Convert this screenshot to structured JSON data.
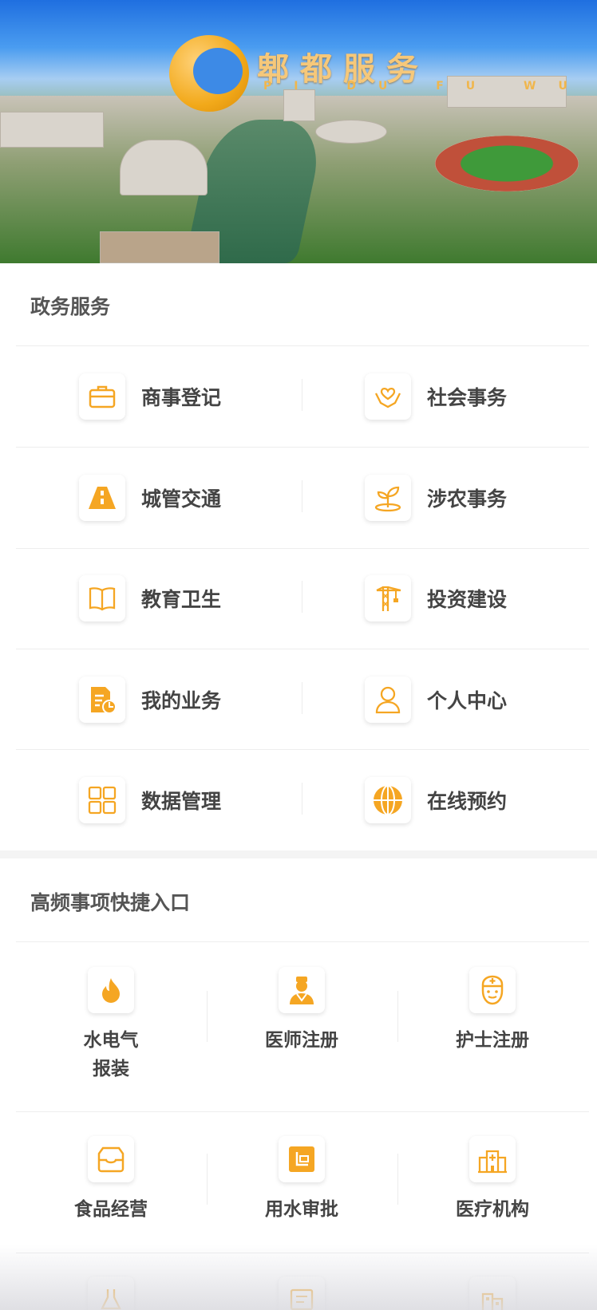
{
  "banner": {
    "title": "郫都服务",
    "subtitle": "PI DU FU WU"
  },
  "gov_section": {
    "title": "政务服务",
    "items": [
      {
        "label": "商事登记",
        "icon": "briefcase-icon"
      },
      {
        "label": "社会事务",
        "icon": "heart-hands-icon"
      },
      {
        "label": "城管交通",
        "icon": "road-icon"
      },
      {
        "label": "涉农事务",
        "icon": "sprout-icon"
      },
      {
        "label": "教育卫生",
        "icon": "book-icon"
      },
      {
        "label": "投资建设",
        "icon": "crane-icon"
      },
      {
        "label": "我的业务",
        "icon": "document-icon"
      },
      {
        "label": "个人中心",
        "icon": "person-icon"
      },
      {
        "label": "数据管理",
        "icon": "grid-icon"
      },
      {
        "label": "在线预约",
        "icon": "globe-icon"
      }
    ]
  },
  "quick_section": {
    "title": "高频事项快捷入口",
    "items": [
      {
        "label": "水电气\n报装",
        "icon": "flame-icon"
      },
      {
        "label": "医师注册",
        "icon": "doctor-icon"
      },
      {
        "label": "护士注册",
        "icon": "nurse-icon"
      },
      {
        "label": "食品经营",
        "icon": "food-box-icon"
      },
      {
        "label": "用水审批",
        "icon": "water-approval-icon"
      },
      {
        "label": "医疗机构",
        "icon": "hospital-icon"
      }
    ]
  },
  "colors": {
    "accent": "#f5a623"
  }
}
